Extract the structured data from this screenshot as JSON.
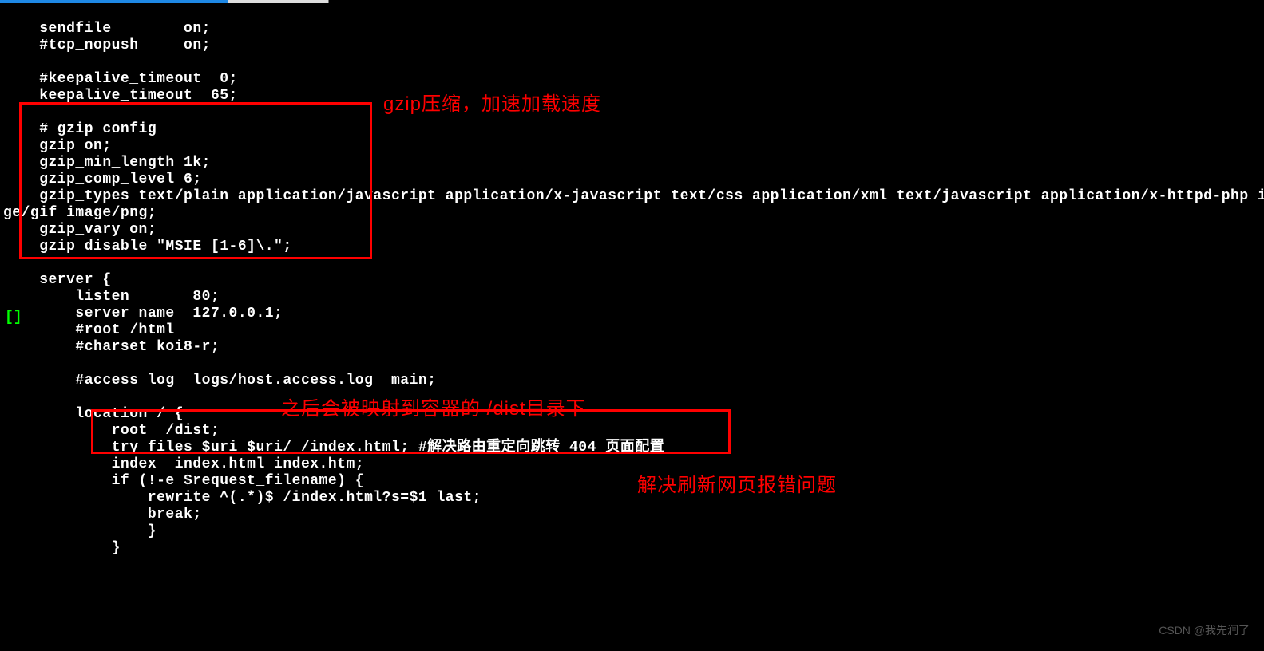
{
  "code": {
    "lines": [
      "    sendfile        on;",
      "    #tcp_nopush     on;",
      "",
      "    #keepalive_timeout  0;",
      "    keepalive_timeout  65;",
      "",
      "    # gzip config",
      "    gzip on;",
      "    gzip_min_length 1k;",
      "    gzip_comp_level 6;",
      "    gzip_types text/plain application/javascript application/x-javascript text/css application/xml text/javascript application/x-httpd-php image",
      "ge/gif image/png;",
      "    gzip_vary on;",
      "    gzip_disable \"MSIE [1-6]\\.\";",
      "",
      "    server {",
      "        listen       80;",
      "        server_name  127.0.0.1;",
      "        #root /html",
      "        #charset koi8-r;",
      "",
      "        #access_log  logs/host.access.log  main;",
      "",
      "        location / {",
      "            root  /dist;",
      "            try_files $uri $uri/ /index.html; #解决路由重定向跳转 404 页面配置",
      "            index  index.html index.htm;",
      "            if (!-e $request_filename) {",
      "                rewrite ^(.*)$ /index.html?s=$1 last;",
      "                break;",
      "                }",
      "            }"
    ],
    "cursor_glyph": "[]"
  },
  "annotations": {
    "box1_label": "gzip压缩，加速加载速度",
    "box2_label": "之后会被映射到容器的 /dist目录下",
    "box3_label": "解决刷新网页报错问题"
  },
  "watermark": "CSDN @我先润了",
  "colors": {
    "background": "#000000",
    "text": "#ffffff",
    "annotation": "#ff0000",
    "cursor": "#00ff00"
  }
}
